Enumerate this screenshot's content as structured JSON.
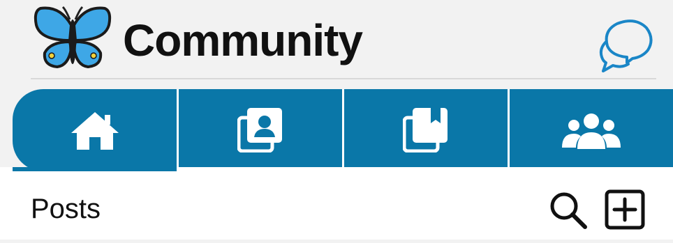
{
  "header": {
    "title": "Community",
    "logo_icon": "butterfly-icon",
    "chat_icon": "chat-bubbles-icon"
  },
  "tabs": [
    {
      "id": "home",
      "icon": "home-icon",
      "active": true
    },
    {
      "id": "profiles",
      "icon": "profile-cards-icon",
      "active": false
    },
    {
      "id": "bookmarks",
      "icon": "bookmark-cards-icon",
      "active": false
    },
    {
      "id": "groups",
      "icon": "users-group-icon",
      "active": false
    }
  ],
  "section": {
    "title": "Posts",
    "search_icon": "search-icon",
    "add_icon": "add-square-icon"
  },
  "colors": {
    "brand_blue": "#0a77a8",
    "accent_chat": "#1a86c7",
    "butterfly_blue": "#3ea7e6",
    "background": "#f2f2f2"
  }
}
